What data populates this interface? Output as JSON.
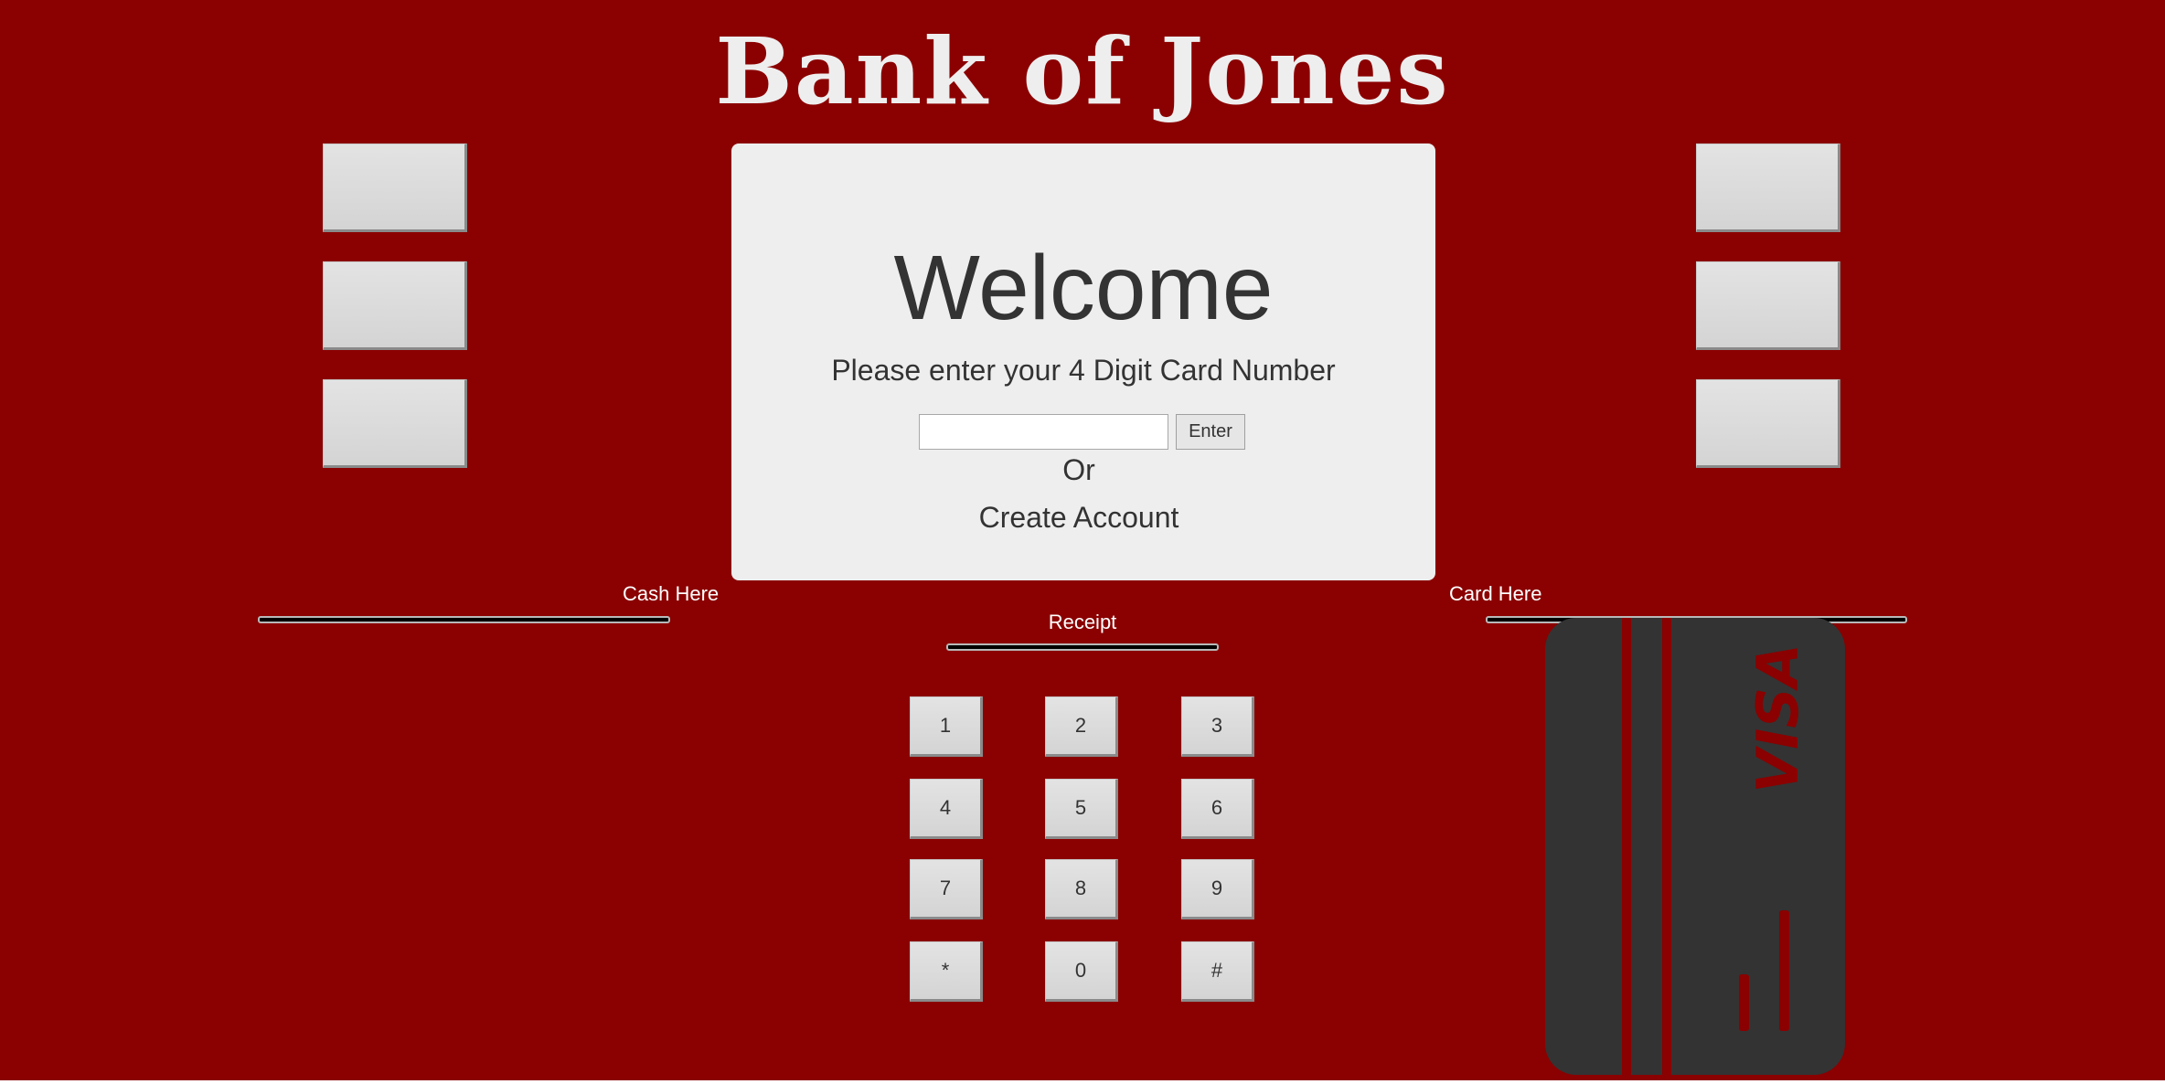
{
  "brand": {
    "title": "Bank of Jones"
  },
  "screen": {
    "heading": "Welcome",
    "prompt": "Please enter your 4 Digit Card Number",
    "card_input": {
      "value": "",
      "placeholder": ""
    },
    "enter_label": "Enter",
    "or_text": "Or",
    "create_account_label": "Create Account"
  },
  "slots": {
    "cash_label": "Cash Here",
    "receipt_label": "Receipt",
    "card_label": "Card Here"
  },
  "keypad": {
    "keys": [
      "1",
      "2",
      "3",
      "4",
      "5",
      "6",
      "7",
      "8",
      "9",
      "*",
      "0",
      "#"
    ]
  },
  "card": {
    "brand_text": "VISA",
    "icon": "credit-card-icon"
  },
  "colors": {
    "background": "#8b0000",
    "screen": "#eeeeee",
    "button": "#dddddd",
    "card": "#333333",
    "text": "#333333"
  }
}
